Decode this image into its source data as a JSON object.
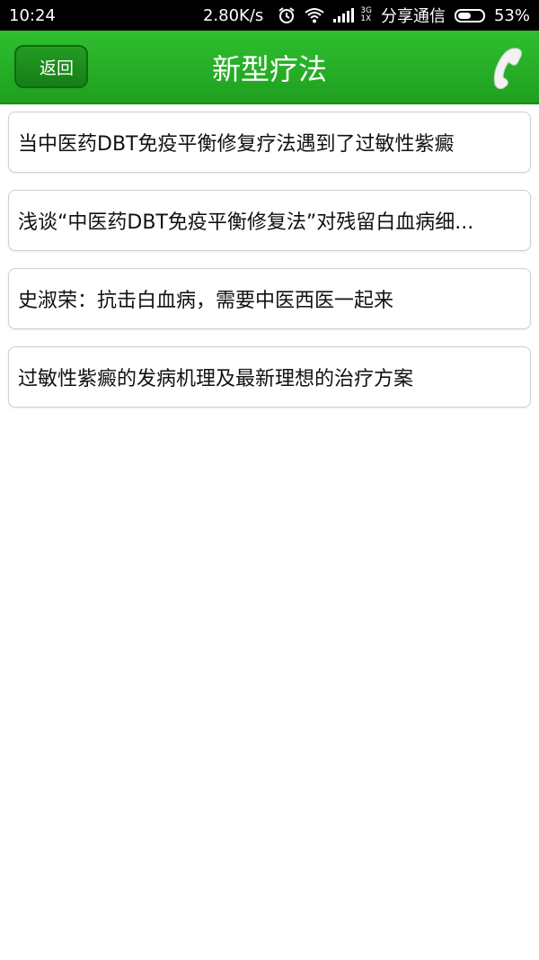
{
  "status_bar": {
    "time": "10:24",
    "network_speed": "2.80K/s",
    "carrier": "分享通信",
    "network_type_top": "3G",
    "network_type_bottom": "1X",
    "battery_percent": "53%",
    "battery_level": 0.53
  },
  "header": {
    "back_label": "返回",
    "title": "新型疗法",
    "accent_color": "#2fb52f"
  },
  "articles": [
    {
      "title": "当中医药DBT免疫平衡修复疗法遇到了过敏性紫癜"
    },
    {
      "title": "浅谈“中医药DBT免疫平衡修复法”对残留白血病细..."
    },
    {
      "title": "史淑荣：抗击白血病，需要中医西医一起来"
    },
    {
      "title": "过敏性紫癜的发病机理及最新理想的治疗方案"
    }
  ]
}
